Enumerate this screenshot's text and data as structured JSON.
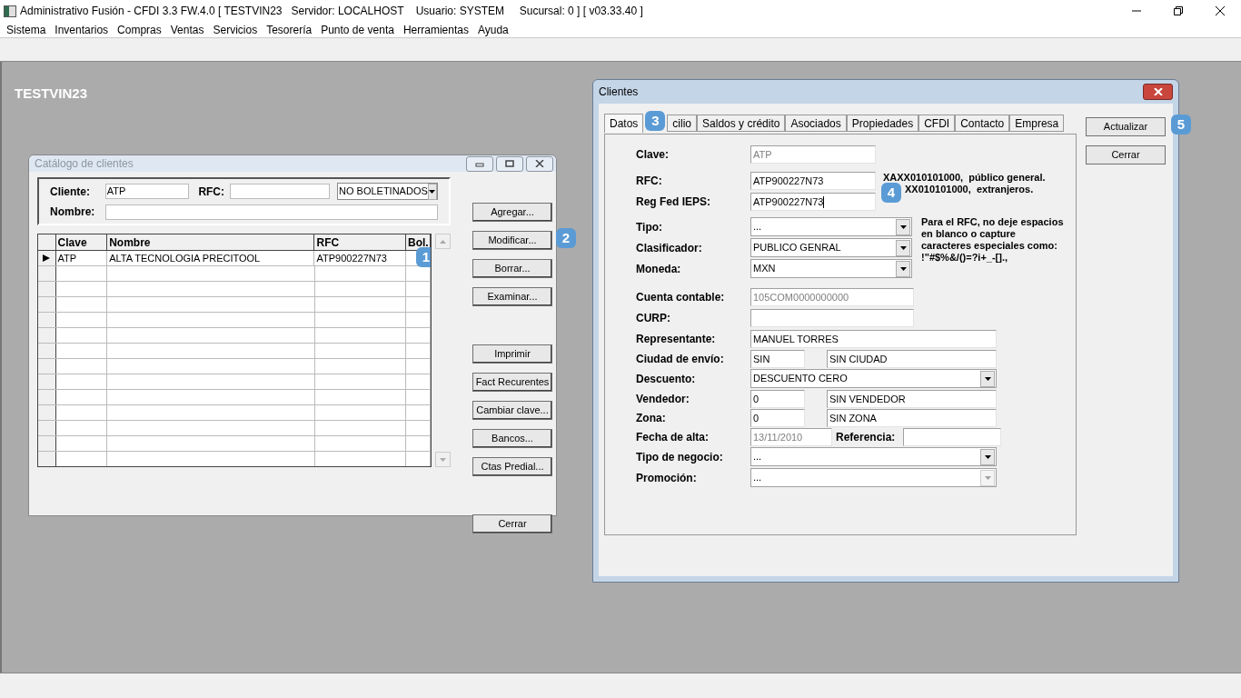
{
  "app": {
    "title": "Administrativo Fusión - CFDI 3.3 FW.4.0 [ TESTVIN23   Servidor: LOCALHOST    Usuario: SYSTEM     Sucursal: 0 ] [ v03.33.40 ]",
    "menu": [
      "Sistema",
      "Inventarios",
      "Compras",
      "Ventas",
      "Servicios",
      "Tesorería",
      "Punto de venta",
      "Herramientas",
      "Ayuda"
    ],
    "company": "TESTVIN23"
  },
  "catalog": {
    "title": "Catálogo de clientes",
    "filter": {
      "cliente_label": "Cliente:",
      "cliente_value": "ATP",
      "rfc_label": "RFC:",
      "status_select": "NO BOLETINADOS",
      "nombre_label": "Nombre:"
    },
    "table": {
      "columns": [
        "Clave",
        "Nombre",
        "RFC",
        "Bol."
      ],
      "rows": [
        {
          "cells": [
            "ATP",
            "ALTA TECNOLOGIA PRECITOOL",
            "ATP900227N73",
            ""
          ],
          "selected": true,
          "badge": "1"
        }
      ]
    },
    "buttons": [
      {
        "label": "Agregar..."
      },
      {
        "label": "Modificar...",
        "badge": "2"
      },
      {
        "label": "Borrar..."
      },
      {
        "label": "Examinar..."
      },
      {
        "label": "Imprimir"
      },
      {
        "label": "Fact Recurentes"
      },
      {
        "label": "Cambiar clave..."
      },
      {
        "label": "Bancos..."
      },
      {
        "label": "Ctas Predial..."
      },
      {
        "label": "Cerrar"
      }
    ]
  },
  "clientes": {
    "title": "Clientes",
    "tabs": [
      {
        "label": "Datos",
        "selected": true
      },
      {
        "label": "cilio",
        "selected": false,
        "badge": "3"
      },
      {
        "label": "Saldos y crédito",
        "selected": false
      },
      {
        "label": "Asociados",
        "selected": false
      },
      {
        "label": "Propiedades",
        "selected": false
      },
      {
        "label": "CFDI",
        "selected": false
      },
      {
        "label": "Contacto",
        "selected": false
      },
      {
        "label": "Empresa",
        "selected": false
      }
    ],
    "rfc_note": [
      "XAXX010101000,  público general.",
      "XX010101000,  extranjeros."
    ],
    "rfc_note_badge": "4",
    "special_note": "Para el RFC, no deje espacios en blanco o capture caracteres especiales como: !\"#$%&/()=?i+_-[].,",
    "fields": [
      {
        "label": "Clave:",
        "kind": "short",
        "value": "ATP",
        "disabled": true
      },
      {
        "label": "RFC:",
        "kind": "short",
        "value": "ATP900227N73",
        "disabled": false
      },
      {
        "label": "Reg Fed IEPS:",
        "kind": "short",
        "value": "ATP900227N73",
        "disabled": false,
        "focused": true
      },
      {
        "label": "Tipo:",
        "kind": "combo",
        "value": "...",
        "disabled": false
      },
      {
        "label": "Clasificador:",
        "kind": "combo",
        "value": "PUBLICO GENRAL",
        "disabled": false
      },
      {
        "label": "Moneda:",
        "kind": "combo",
        "value": "MXN",
        "disabled": false
      },
      {
        "label": "Cuenta contable:",
        "kind": "medium",
        "value": "105COM0000000000",
        "disabled": true
      },
      {
        "label": "CURP:",
        "kind": "medium"
      },
      {
        "label": "Representante:",
        "kind": "long",
        "value": "MANUEL TORRES",
        "disabled": false
      },
      {
        "label": "Ciudad de envío:",
        "kind": "pair",
        "value": "SIN",
        "description": "SIN CIUDAD",
        "disabled": false
      },
      {
        "label": "Descuento:",
        "kind": "wide_combo",
        "value": "DESCUENTO CERO",
        "disabled": false
      },
      {
        "label": "Vendedor:",
        "kind": "pair",
        "value": "0",
        "description": "SIN VENDEDOR",
        "disabled": false
      },
      {
        "label": "Zona:",
        "kind": "pair",
        "value": "0",
        "description": "SIN ZONA",
        "disabled": false
      },
      {
        "label": "Fecha de alta:",
        "kind": "date_ref",
        "value": "13/11/2010",
        "disabled": true,
        "ref_label": "Referencia:"
      },
      {
        "label": "Tipo de negocio:",
        "kind": "wide_combo",
        "value": "...",
        "disabled": false
      },
      {
        "label": "Promoción:",
        "kind": "wide_combo",
        "value": "...",
        "disabled": true
      }
    ],
    "buttons": [
      {
        "label": "Actualizar",
        "badge": "5"
      },
      {
        "label": "Cerrar"
      }
    ]
  }
}
